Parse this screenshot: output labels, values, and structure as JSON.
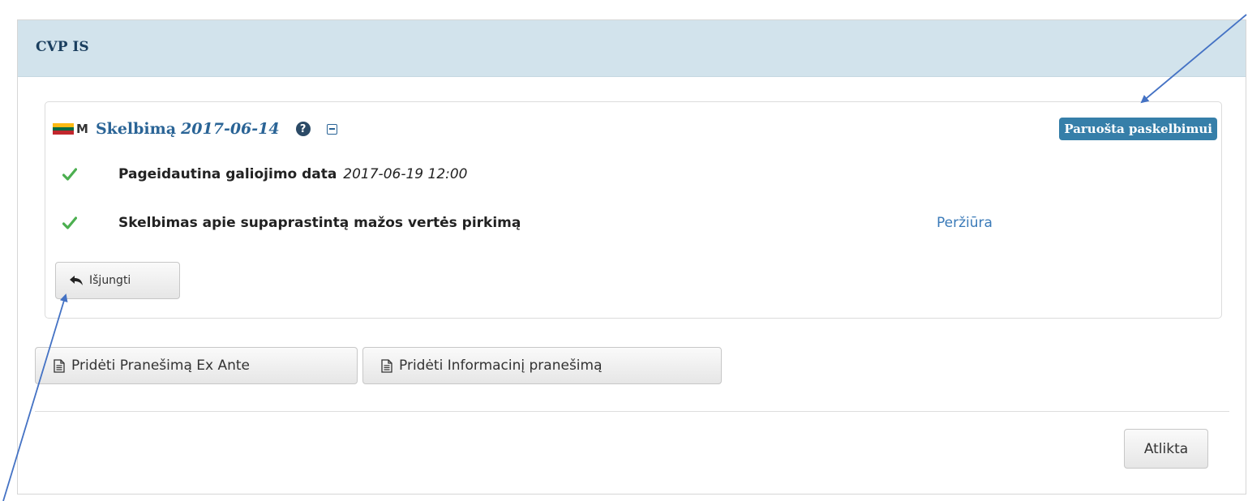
{
  "panel": {
    "title": "CVP IS"
  },
  "notice": {
    "type_letter": "M",
    "title": "Skelbimą",
    "date": "2017-06-14",
    "help_glyph": "?",
    "status": "Paruošta paskelbimui",
    "flag_colors": [
      "#fdb913",
      "#006a44",
      "#c1272d"
    ]
  },
  "rows": [
    {
      "label": "Pageidautina galiojimo data",
      "value": "2017-06-19 12:00"
    },
    {
      "label": "Skelbimas apie supaprastintą mažos vertės pirkimą",
      "link": "Peržiūra"
    }
  ],
  "buttons": {
    "disable": "Išjungti",
    "add_ex_ante": "Pridėti Pranešimą Ex Ante",
    "add_info": "Pridėti Informacinį pranešimą",
    "done": "Atlikta"
  },
  "icons": {
    "check": "check-icon",
    "undo": "undo-arrow-icon",
    "document": "document-icon",
    "help": "question-circle-icon",
    "collapse": "minus-square-icon"
  },
  "colors": {
    "header_bg": "#d2e3ec",
    "link": "#2a6496",
    "badge": "#367fa9",
    "check": "#4caf50",
    "annotation_arrow": "#4472c4"
  }
}
